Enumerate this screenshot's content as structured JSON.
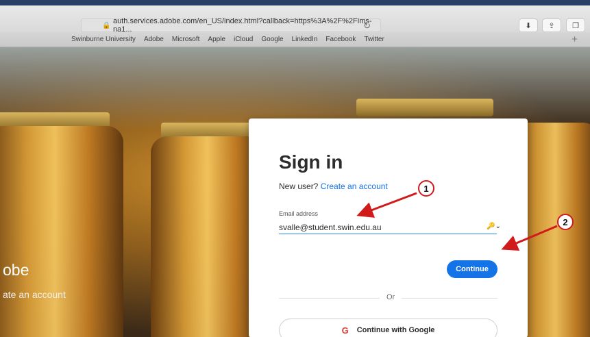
{
  "browser": {
    "url": "auth.services.adobe.com/en_US/index.html?callback=https%3A%2F%2Fims-na1..."
  },
  "bookmarks": [
    "Swinburne University",
    "Adobe",
    "Microsoft",
    "Apple",
    "iCloud",
    "Google",
    "LinkedIn",
    "Facebook",
    "Twitter"
  ],
  "background": {
    "brand_title": "obe",
    "brand_sub": "ate an account"
  },
  "signin": {
    "title": "Sign in",
    "new_user_text": "New user?",
    "create_account_link": "Create an account",
    "email_label": "Email address",
    "email_value": "svalle@student.swin.edu.au",
    "continue_label": "Continue",
    "or_label": "Or",
    "google_label": "Continue with Google"
  },
  "annotations": {
    "callout_1": "1",
    "callout_2": "2"
  },
  "colors": {
    "accent": "#1473e6",
    "annotation_red": "#d11a1a"
  }
}
